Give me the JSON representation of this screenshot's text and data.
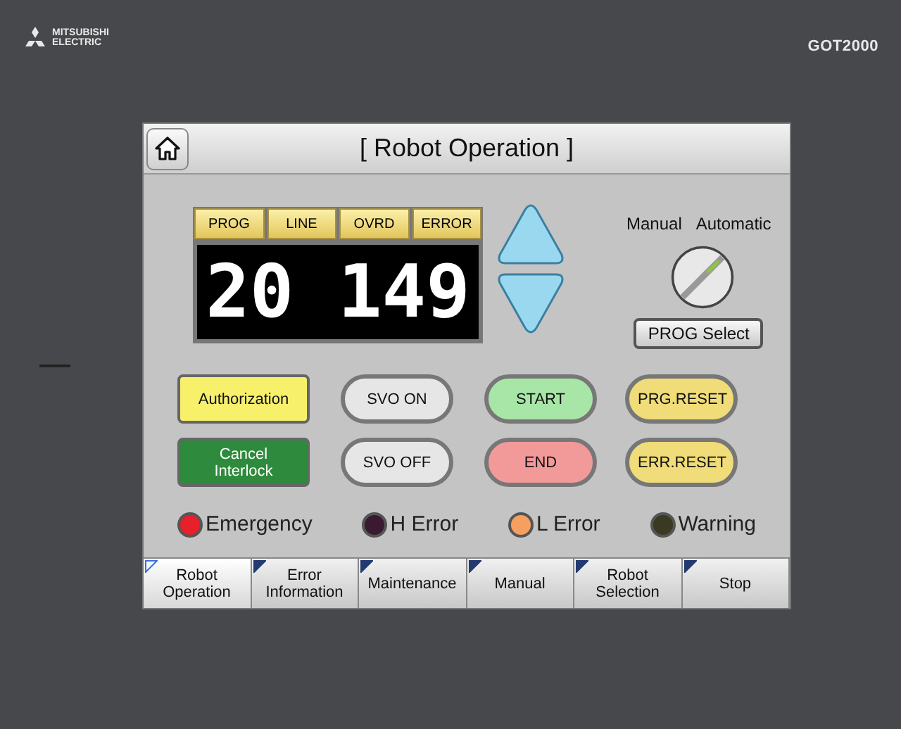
{
  "device": {
    "logo": [
      "MITSUBISHI",
      "ELECTRIC"
    ],
    "model": "GOT2000"
  },
  "screen": {
    "title": "[ Robot Operation ]",
    "display": {
      "labels": [
        "PROG",
        "LINE",
        "OVRD",
        "ERROR"
      ],
      "value": "20 149"
    },
    "mode_switch": {
      "labels": [
        "Manual",
        "Automatic"
      ],
      "automatic": true
    },
    "prog_select": "PROG Select",
    "buttons": [
      {
        "label": "Authorization",
        "kind": "rect",
        "color": "#f7f06a"
      },
      {
        "label": "SVO ON",
        "kind": "pill",
        "color": "#e6e6e6"
      },
      {
        "label": "START",
        "kind": "pill",
        "color": "#a8e6a8"
      },
      {
        "label": "PRG.RESET",
        "kind": "pill",
        "color": "#f0dc78"
      },
      {
        "label": "Cancel Interlock",
        "kind": "rect",
        "color": "#2e8a3c"
      },
      {
        "label": "SVO OFF",
        "kind": "pill",
        "color": "#e6e6e6"
      },
      {
        "label": "END",
        "kind": "pill",
        "color": "#f29a9a"
      },
      {
        "label": "ERR.RESET",
        "kind": "pill",
        "color": "#f0dc78"
      }
    ],
    "lamps": [
      {
        "label": "Emergency",
        "color": "#e8202a"
      },
      {
        "label": "H Error",
        "color": "#3a1a30"
      },
      {
        "label": "L Error",
        "color": "#f5a060"
      },
      {
        "label": "Warning",
        "color": "#3a3a22"
      }
    ],
    "tabs": [
      {
        "label": "Robot Operation",
        "selected": true
      },
      {
        "label": "Error Information",
        "selected": false
      },
      {
        "label": "Maintenance",
        "selected": false
      },
      {
        "label": "Manual",
        "selected": false
      },
      {
        "label": "Robot Selection",
        "selected": false
      },
      {
        "label": "Stop",
        "selected": false
      }
    ]
  }
}
